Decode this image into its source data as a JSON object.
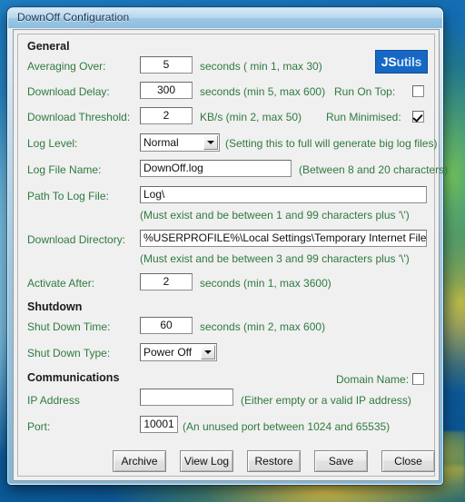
{
  "window": {
    "title": "DownOff Configuration",
    "logo": {
      "part1": "JS",
      "part2": "utils"
    }
  },
  "groups": {
    "general": "General",
    "shutdown": "Shutdown",
    "communications": "Communications"
  },
  "fields": {
    "averaging_over": {
      "label": "Averaging Over:",
      "value": "5",
      "hint": "seconds ( min 1, max 30)"
    },
    "download_delay": {
      "label": "Download Delay:",
      "value": "300",
      "hint": "seconds (min 5, max 600)"
    },
    "download_threshold": {
      "label": "Download Threshold:",
      "value": "2",
      "hint": "KB/s (min 2, max 50)"
    },
    "log_level": {
      "label": "Log Level:",
      "value": "Normal",
      "hint": "(Setting this to full will generate big log files)"
    },
    "log_file_name": {
      "label": "Log File Name:",
      "value": "DownOff.log",
      "hint": "(Between 8 and 20 characters)"
    },
    "path_to_log_file": {
      "label": "Path To Log File:",
      "value": "Log\\",
      "hint": "(Must exist and be between 1 and 99 characters plus '\\')"
    },
    "download_directory": {
      "label": "Download Directory:",
      "value": "%USERPROFILE%\\Local Settings\\Temporary Internet Files\\",
      "hint": "(Must exist and be between 3 and 99 characters plus '\\')"
    },
    "activate_after": {
      "label": "Activate After:",
      "value": "2",
      "hint": "seconds (min 1, max 3600)"
    },
    "shut_down_time": {
      "label": "Shut Down Time:",
      "value": "60",
      "hint": "seconds (min 2, max 600)"
    },
    "shut_down_type": {
      "label": "Shut Down Type:",
      "value": "Power Off"
    },
    "ip_address": {
      "label": "IP Address",
      "value": "",
      "placeholder": "",
      "hint": "(Either empty or a valid IP address)"
    },
    "port": {
      "label": "Port:",
      "value": "10001",
      "hint": "(An unused port between 1024 and 65535)"
    }
  },
  "checkboxes": {
    "run_on_top": {
      "label": "Run On Top:",
      "checked": false
    },
    "run_minimised": {
      "label": "Run Minimised:",
      "checked": true
    },
    "domain_name": {
      "label": "Domain Name:",
      "checked": false
    }
  },
  "buttons": {
    "archive": "Archive",
    "view_log": "View Log",
    "restore": "Restore",
    "save": "Save",
    "close": "Close"
  },
  "colors": {
    "label_green": "#2f7a3f",
    "logo_blue": "#1668c4",
    "window_chrome": "#9cc6e4"
  }
}
